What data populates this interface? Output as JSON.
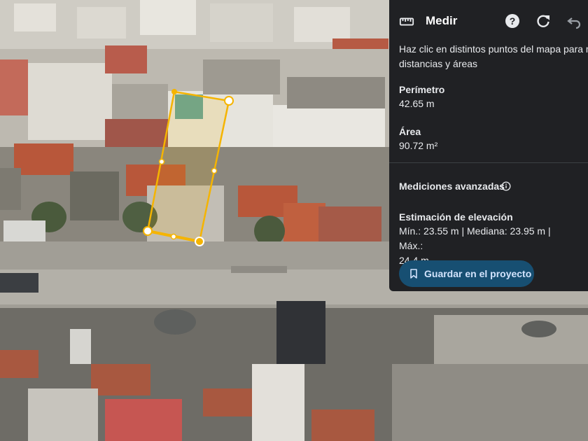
{
  "panel": {
    "title": "Medir",
    "instruction_line1": "Haz clic en distintos puntos del mapa para medir",
    "instruction_line2": "distancias y áreas",
    "perimeter_label": "Perímetro",
    "perimeter_value": "42.65 m",
    "area_label": "Área",
    "area_value": "90.72 m²",
    "advanced_label": "Mediciones avanzadas",
    "elevation_label": "Estimación de elevación",
    "elevation_line1": "Mín.: 23.55 m | Mediana: 23.95 m | Máx.:",
    "elevation_line2": "24.4 m",
    "save_button_label": "Guardar en el proyecto"
  },
  "icons": {
    "ruler": "ruler-icon",
    "help": "help-icon",
    "refresh": "refresh-icon",
    "undo": "undo-icon",
    "info": "info-icon",
    "bookmark": "bookmark-icon"
  },
  "colors": {
    "panel_bg": "#202124",
    "measure_line": "#f5b400",
    "save_button": "#174f72"
  }
}
